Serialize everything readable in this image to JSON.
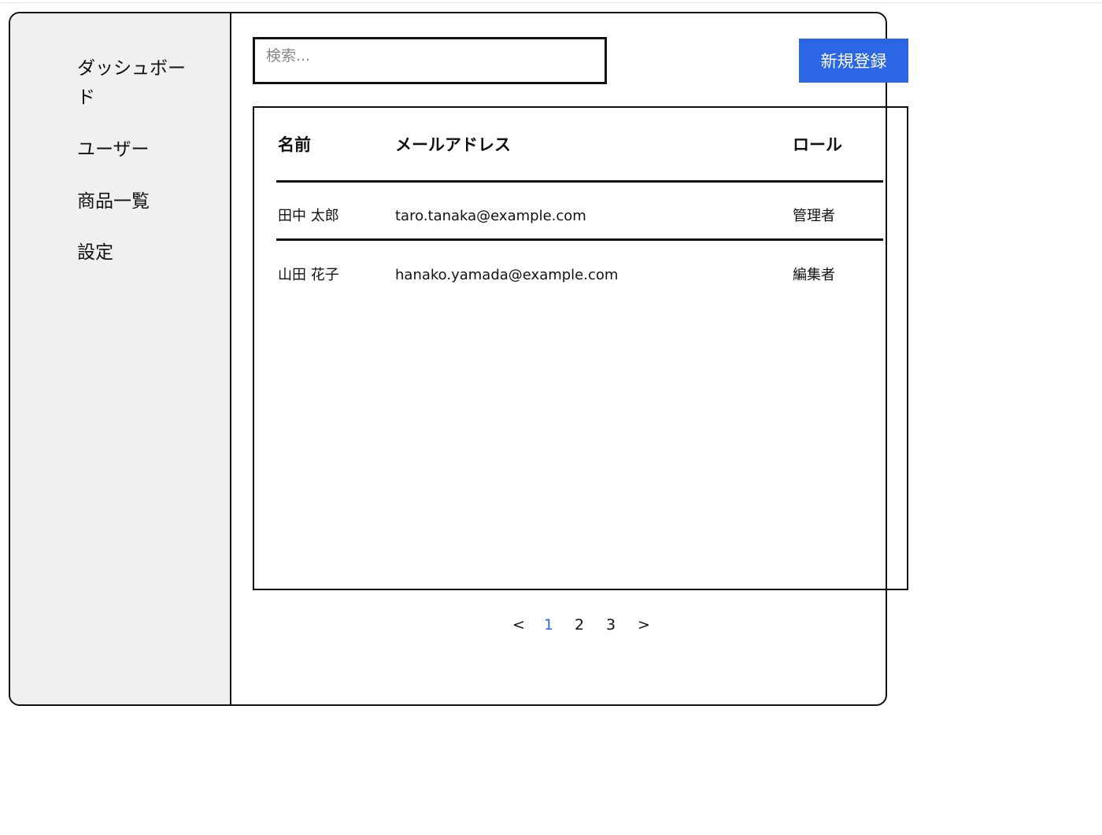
{
  "sidebar": {
    "items": [
      {
        "label": "ダッシュボード"
      },
      {
        "label": "ユーザー"
      },
      {
        "label": "商品一覧"
      },
      {
        "label": "設定"
      }
    ]
  },
  "search": {
    "placeholder": "検索...",
    "value": ""
  },
  "toolbar": {
    "new_label": "新規登録",
    "accent_color": "#2b67e4"
  },
  "table": {
    "headers": {
      "name": "名前",
      "email": "メールアドレス",
      "role": "ロール"
    },
    "rows": [
      {
        "name": "田中 太郎",
        "email": "taro.tanaka@example.com",
        "role": "管理者"
      },
      {
        "name": "山田 花子",
        "email": "hanako.yamada@example.com",
        "role": "編集者"
      }
    ]
  },
  "pagination": {
    "prev": "<",
    "pages": [
      "1",
      "2",
      "3"
    ],
    "current": "1",
    "next": ">"
  }
}
